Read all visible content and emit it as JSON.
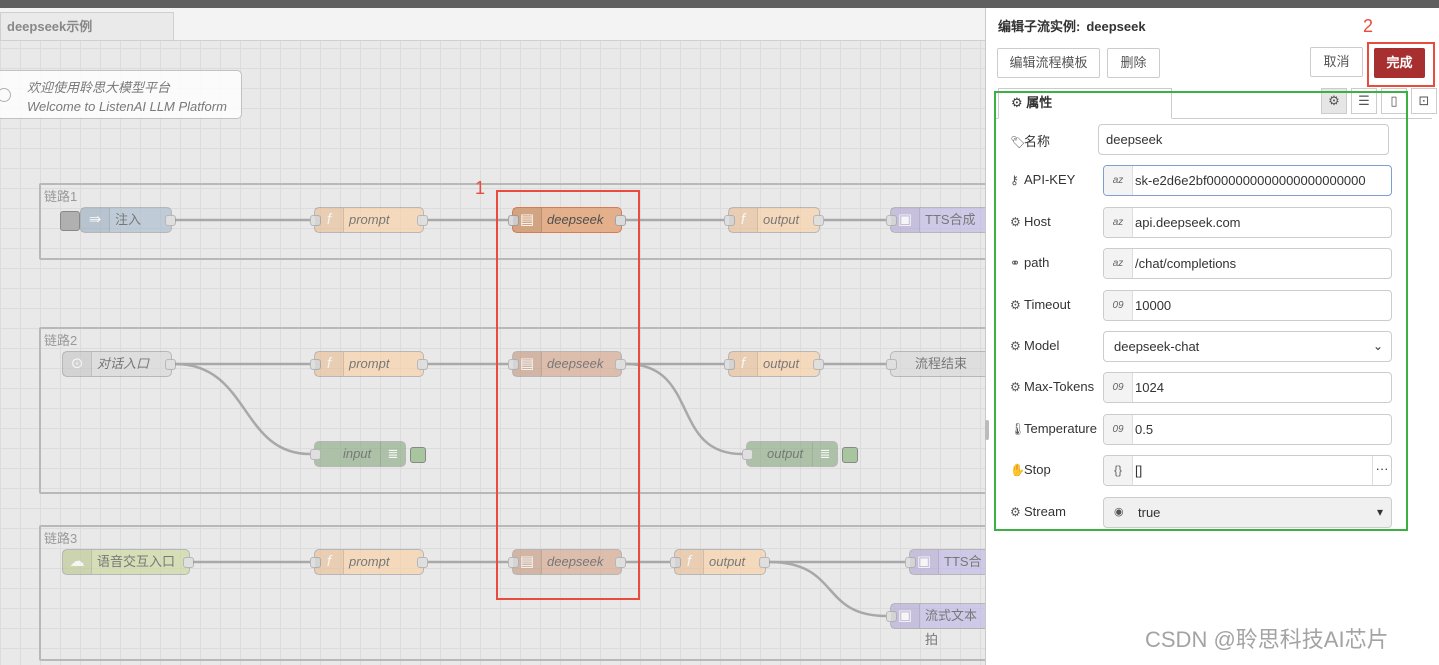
{
  "workspace": {
    "tab_label": "deepseek示例",
    "comment": {
      "line1": "欢迎使用聆思大模型平台",
      "line2": "Welcome to ListenAI LLM Platform"
    },
    "groups": [
      {
        "label": "链路1"
      },
      {
        "label": "链路2"
      },
      {
        "label": "链路3"
      }
    ],
    "nodes": {
      "g1_inject": "注入",
      "g1_prompt": "prompt",
      "g1_deepseek": "deepseek",
      "g1_output": "output",
      "g1_tts": "TTS合成",
      "g2_entry": "对话入口",
      "g2_prompt": "prompt",
      "g2_deepseek": "deepseek",
      "g2_output": "output",
      "g2_end": "流程结束",
      "g2_input_debug": "input",
      "g2_output_debug": "output",
      "g3_entry": "语音交互入口",
      "g3_prompt": "prompt",
      "g3_deepseek": "deepseek",
      "g3_output": "output",
      "g3_tts": "TTS合",
      "g3_stream": "流式文本拍"
    },
    "annotation_1": "1",
    "annotation_2": "2"
  },
  "panel": {
    "title": "编辑子流实例:",
    "title_name": "deepseek",
    "edit_template_label": "编辑流程模板",
    "delete_label": "删除",
    "cancel_label": "取消",
    "done_label": "完成",
    "properties_tab": "属性",
    "fields": {
      "name": {
        "label": "名称",
        "value": "deepseek"
      },
      "api_key": {
        "label": "API-KEY",
        "value": "sk-e2d6e2bf0000000000000000000000"
      },
      "host": {
        "label": "Host",
        "value": "api.deepseek.com"
      },
      "path": {
        "label": "path",
        "value": "/chat/completions"
      },
      "timeout": {
        "label": "Timeout",
        "value": "10000"
      },
      "model": {
        "label": "Model",
        "value": "deepseek-chat"
      },
      "max_tokens": {
        "label": "Max-Tokens",
        "value": "1024"
      },
      "temperature": {
        "label": "Temperature",
        "value": "0.5"
      },
      "stop": {
        "label": "Stop",
        "value": "[]"
      },
      "stream": {
        "label": "Stream",
        "value": "true"
      }
    }
  },
  "watermark": "CSDN @聆思科技AI芯片",
  "colors": {
    "done_button": "#a72f2f",
    "highlight_red": "#e74c3c",
    "highlight_green": "#3cb043"
  }
}
